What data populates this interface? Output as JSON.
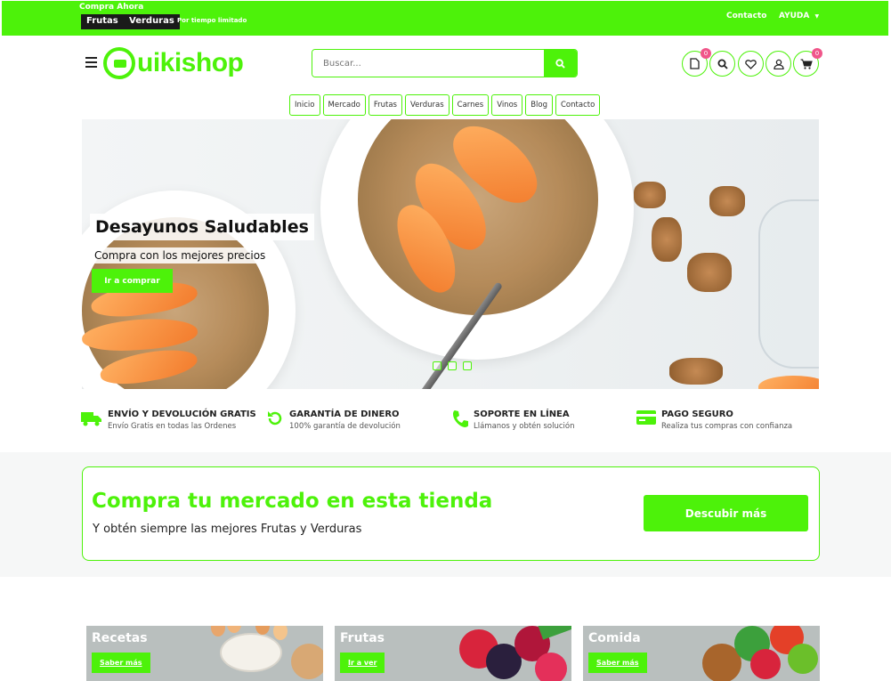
{
  "topbar": {
    "promo_label": "Compra Ahora",
    "tags": [
      "Frutas",
      "Verduras"
    ],
    "promo_note": "Por tiempo limitado",
    "contact_link": "Contacto",
    "help_link": "AYUDA",
    "help_icon": "chevron-down-icon"
  },
  "header": {
    "logo_text": "uikishop",
    "search": {
      "placeholder": "Buscar...",
      "value": ""
    },
    "icons": [
      {
        "name": "document-icon",
        "badge": "0"
      },
      {
        "name": "search-icon"
      },
      {
        "name": "heart-icon"
      },
      {
        "name": "user-icon"
      },
      {
        "name": "cart-icon",
        "badge": "0"
      }
    ]
  },
  "nav": [
    "Inicio",
    "Mercado",
    "Frutas",
    "Verduras",
    "Carnes",
    "Vinos",
    "Blog",
    "Contacto"
  ],
  "hero": {
    "title": "Desayunos Saludables",
    "subtitle": "Compra con los mejores precios",
    "button": "Ir a comprar",
    "slides": 3,
    "active_slide": 1
  },
  "features": [
    {
      "icon": "truck-icon",
      "title": "ENVÍO Y DEVOLUCIÓN GRATIS",
      "subtitle": "Envío Gratis en todas las Ordenes"
    },
    {
      "icon": "refresh-icon",
      "title": "GARANTÍA DE DINERO",
      "subtitle": "100% garantía de devolución"
    },
    {
      "icon": "phone-icon",
      "title": "SOPORTE EN LÍNEA",
      "subtitle": "Llámanos y obtén solución"
    },
    {
      "icon": "credit-card-icon",
      "title": "PAGO SEGURO",
      "subtitle": "Realiza tus compras con confianza"
    }
  ],
  "promo_band": {
    "title": "Compra tu mercado en esta tienda",
    "subtitle": "Y obtén siempre las mejores Frutas y Verduras",
    "button": "Descubir más"
  },
  "categories": [
    {
      "title": "Recetas",
      "button": "Saber más"
    },
    {
      "title": "Frutas",
      "button": "Ir a ver"
    },
    {
      "title": "Comida",
      "button": "Saber más"
    }
  ],
  "colors": {
    "accent": "#4df20a",
    "badge": "#f0568a",
    "dark": "#1a1a1a"
  }
}
